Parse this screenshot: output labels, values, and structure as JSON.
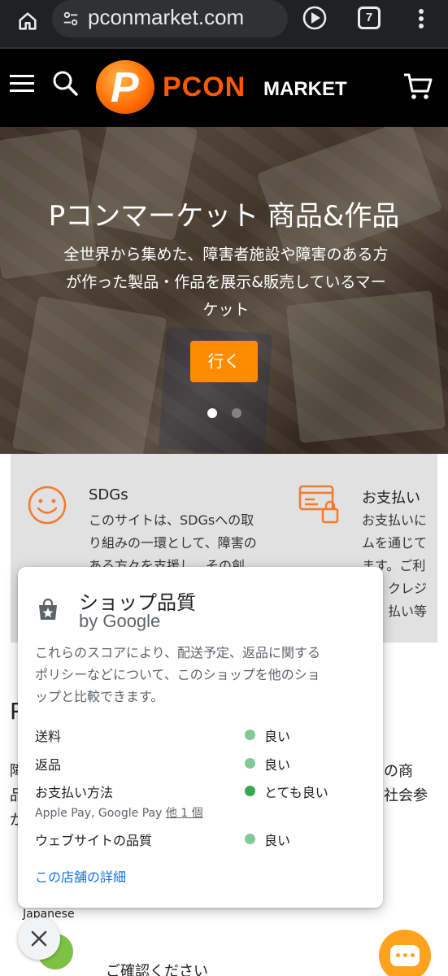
{
  "browser": {
    "url": "pconmarket.com",
    "tab_count": "7"
  },
  "header": {
    "logo_brand": "PCON",
    "logo_suffix": "MARKET",
    "logo_letter": "P"
  },
  "hero": {
    "title": "Pコンマーケット 商品&作品",
    "subtitle_lines": [
      "全世界から集めた、障害者施設や障害のある方",
      "が作った製品・作品を展示&販売しているマー",
      "ケット"
    ],
    "button_label": "行く",
    "active_slide": 0,
    "slide_count": 2
  },
  "features": [
    {
      "title": "SDGs",
      "desc_lines": [
        "このサイトは、SDGsへの取",
        "り組みの一環として、障害の",
        "ある方々を支援し、その創"
      ]
    },
    {
      "title": "お支払い",
      "desc_lines": [
        "お支払いに",
        "ムを通じて",
        "ます。ご利",
        "クレジ",
        "払い等"
      ]
    }
  ],
  "background": {
    "heading_fragment": "P",
    "left_chars": [
      "障",
      "品",
      "か"
    ],
    "right_lines": [
      "の商",
      "社会参"
    ],
    "language": "Japanese",
    "partial_text": "ご確認ください"
  },
  "popup": {
    "title": "ショップ品質",
    "subtitle": "by Google",
    "description_lines": [
      "これらのスコアにより、配送予定、返品に関する",
      "ポリシーなどについて、このショップを他のショ",
      "ップと比較できます。"
    ],
    "rows": [
      {
        "label": "送料",
        "value": "良い",
        "dot_color": "#81c995"
      },
      {
        "label": "返品",
        "value": "良い",
        "dot_color": "#81c995"
      },
      {
        "label": "お支払い方法",
        "value": "とても良い",
        "dot_color": "#34a853",
        "note": "Apple Pay, Google Pay",
        "note_link": "他 1 個"
      },
      {
        "label": "ウェブサイトの品質",
        "value": "良い",
        "dot_color": "#81c995"
      }
    ],
    "details_link": "この店舗の詳細"
  },
  "colors": {
    "accent_orange": "#ff8c00",
    "icon_orange": "#f4792b",
    "link_blue": "#1a73e8"
  }
}
